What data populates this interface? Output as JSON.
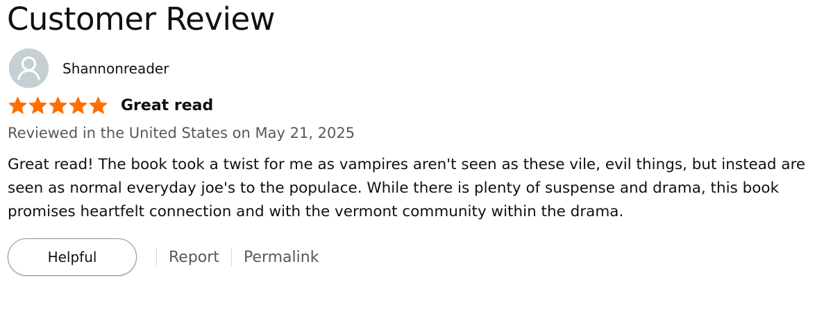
{
  "page_title": "Customer Review",
  "reviewer": {
    "name": "Shannonreader",
    "avatar_icon": "default-user-avatar-icon"
  },
  "review": {
    "rating": 5,
    "rating_max": 5,
    "star_color": "#ff6f00",
    "title": "Great read",
    "date_line": "Reviewed in the United States on May 21, 2025",
    "body": "Great read! The book took a twist for me as vampires aren't seen as these vile, evil things, but instead are seen as normal everyday joe's to the populace. While there is plenty of suspense and drama, this book promises heartfelt connection and with the vermont community within the drama."
  },
  "actions": {
    "helpful_label": "Helpful",
    "report_label": "Report",
    "permalink_label": "Permalink"
  }
}
